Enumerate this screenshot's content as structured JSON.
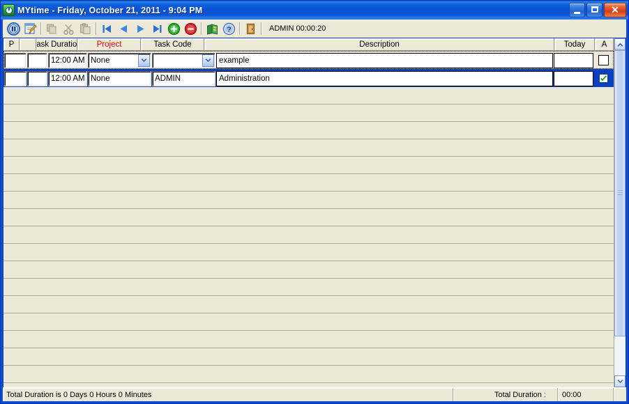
{
  "window": {
    "title": "MYtime - Friday, October 21, 2011 - 9:04 PM",
    "icon": "clock-app-icon",
    "minimize_label": "Minimize",
    "maximize_label": "Maximize",
    "close_label": "Close",
    "close_glyph": "✕"
  },
  "toolbar": {
    "status_text": "ADMIN 00:00:20",
    "buttons": [
      {
        "name": "pause-button",
        "icon": "pause-icon",
        "tooltip": "Pause"
      },
      {
        "name": "edit-button",
        "icon": "edit-note-icon",
        "tooltip": "Edit"
      },
      {
        "name": "copy-button",
        "icon": "copy-icon",
        "tooltip": "Copy"
      },
      {
        "name": "cut-button",
        "icon": "scissors-icon",
        "tooltip": "Cut"
      },
      {
        "name": "paste-button",
        "icon": "paste-icon",
        "tooltip": "Paste"
      },
      {
        "name": "first-record-button",
        "icon": "skip-first-icon",
        "tooltip": "First"
      },
      {
        "name": "previous-record-button",
        "icon": "prev-icon",
        "tooltip": "Previous"
      },
      {
        "name": "next-record-button",
        "icon": "next-icon",
        "tooltip": "Next"
      },
      {
        "name": "last-record-button",
        "icon": "skip-last-icon",
        "tooltip": "Last"
      },
      {
        "name": "add-record-button",
        "icon": "add-green-icon",
        "tooltip": "Add"
      },
      {
        "name": "delete-record-button",
        "icon": "delete-red-icon",
        "tooltip": "Delete"
      },
      {
        "name": "reports-button",
        "icon": "book-icon",
        "tooltip": "Reports"
      },
      {
        "name": "help-button",
        "icon": "help-icon",
        "tooltip": "Help"
      },
      {
        "name": "exit-button",
        "icon": "door-exit-icon",
        "tooltip": "Exit"
      }
    ]
  },
  "grid": {
    "columns": [
      {
        "key": "p",
        "label": "P",
        "accent": false
      },
      {
        "key": "marker",
        "label": "",
        "accent": false
      },
      {
        "key": "task_duration",
        "label": "Task Duration",
        "accent": false
      },
      {
        "key": "project",
        "label": "Project",
        "accent": true
      },
      {
        "key": "task_code",
        "label": "Task Code",
        "accent": false
      },
      {
        "key": "description",
        "label": "Description",
        "accent": false
      },
      {
        "key": "today",
        "label": "Today",
        "accent": false
      },
      {
        "key": "a",
        "label": "A",
        "accent": false
      }
    ],
    "rows": [
      {
        "state": "editing",
        "p": "",
        "marker": "",
        "task_duration": "12:00 AM",
        "project": "None",
        "task_code": "",
        "description": "example",
        "today": "",
        "a_checked": false
      },
      {
        "state": "selected",
        "p": "",
        "marker": "",
        "task_duration": "12:00 AM",
        "project": "None",
        "task_code": "ADMIN",
        "description": "Administration",
        "today": "",
        "a_checked": true
      }
    ],
    "empty_row_count": 18,
    "scrollbar": {
      "up_arrow": "scroll-up-icon",
      "down_arrow": "scroll-down-icon",
      "thumb_label": "vertical-scroll-thumb"
    }
  },
  "statusbar": {
    "total_duration_sentence": "Total Duration is 0 Days 0 Hours 0 Minutes",
    "total_duration_label": "Total Duration :",
    "total_duration_value": "00:00"
  },
  "colors": {
    "title_blue": "#0a4fd6",
    "client_beige": "#ece9d8",
    "grid_beige": "#ece9d8",
    "selection_blue": "#0a3fc0",
    "accent_red": "#e8000b",
    "close_red": "#d33d17"
  }
}
